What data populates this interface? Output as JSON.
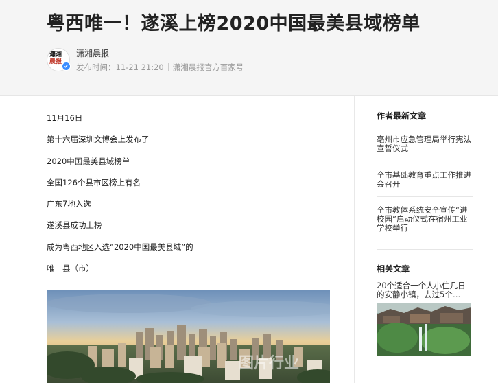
{
  "header": {
    "title": "粤西唯一！遂溪上榜2020中国最美县域榜单",
    "avatar_line1": "瀟湘",
    "avatar_line2": "晨报",
    "author": "潇湘晨报",
    "publish_label": "发布时间：11-21  21:20",
    "source": "潇湘晨报官方百家号"
  },
  "article": {
    "paragraphs": [
      "11月16日",
      "第十六届深圳文博会上发布了",
      "2020中国最美县域榜单",
      "全国126个县市区榜上有名",
      "广东7地入选",
      "遂溪县成功上榜",
      "成为粤西地区入选“2020中国最美县域”的",
      "唯一县（市）"
    ],
    "watermark": "图片行业"
  },
  "sidebar": {
    "latest_title": "作者最新文章",
    "latest": [
      "亳州市应急管理局举行宪法宣誓仪式",
      "全市基础教育重点工作推进会召开",
      "全市教体系统安全宣传“进校园”启动仪式在宿州工业学校举行"
    ],
    "related_title": "相关文章",
    "related": [
      "20个适合一个人小住几日的安静小镇，去过5个…"
    ]
  }
}
